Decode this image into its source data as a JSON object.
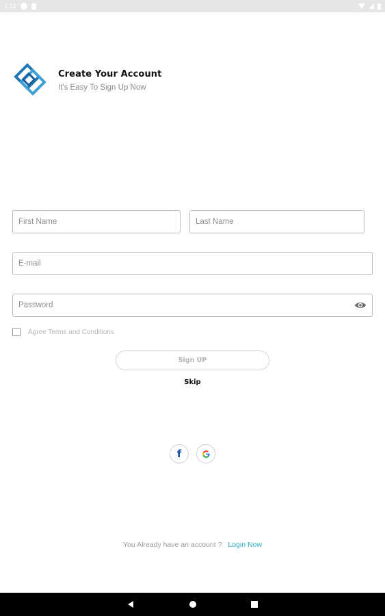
{
  "status_bar": {
    "time": "1:13",
    "icons": [
      "app-notification-icon",
      "sd-card-icon",
      "wifi-icon",
      "signal-icon",
      "battery-icon"
    ]
  },
  "header": {
    "title": "Create Your Account",
    "subtitle": "It's Easy To Sign Up Now",
    "logo_icon": "diamond-logo-icon"
  },
  "form": {
    "first_name_placeholder": "First Name",
    "last_name_placeholder": "Last Name",
    "email_placeholder": "E-mail",
    "password_placeholder": "Password",
    "password_toggle_icon": "eye-icon",
    "terms_label": "Agree Terms and Conditions",
    "signup_label": "Sign UP",
    "skip_label": "Skip"
  },
  "social": {
    "facebook_icon": "facebook-icon",
    "google_icon": "google-icon",
    "facebook_glyph": "f"
  },
  "footer": {
    "text": "You Already have an account ?",
    "link": "Login Now"
  },
  "colors": {
    "accent_link": "#29a8c5",
    "logo_blue": "#1f78b4",
    "facebook_blue": "#1b4fa8"
  },
  "nav_bar": {
    "icons": [
      "back-icon",
      "home-icon",
      "recents-icon"
    ]
  }
}
